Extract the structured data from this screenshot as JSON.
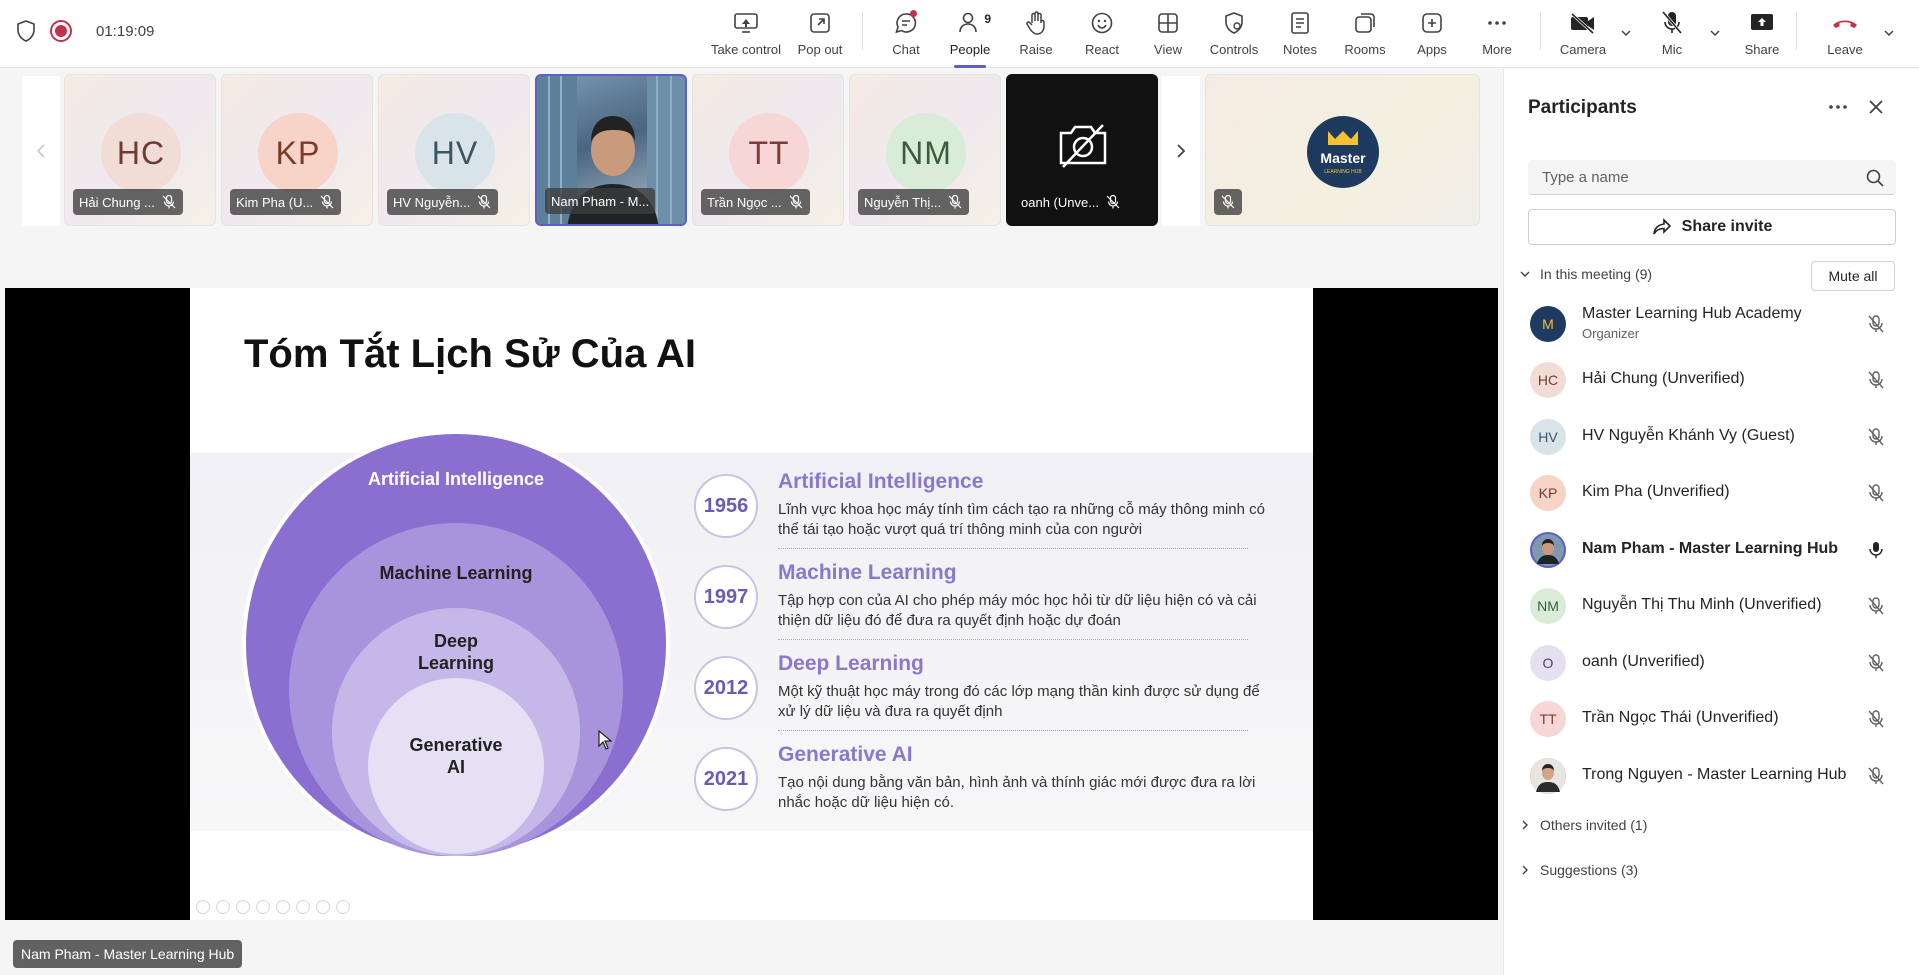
{
  "meeting": {
    "timer": "01:19:09"
  },
  "toolbar": {
    "take_control": "Take control",
    "pop_out": "Pop out",
    "chat": "Chat",
    "people": "People",
    "people_count": "9",
    "raise": "Raise",
    "react": "React",
    "view": "View",
    "controls": "Controls",
    "notes": "Notes",
    "rooms": "Rooms",
    "apps": "Apps",
    "more": "More",
    "camera": "Camera",
    "mic": "Mic",
    "share": "Share",
    "leave": "Leave"
  },
  "gallery": {
    "tiles": [
      {
        "initials": "HC",
        "name": "Hải Chung ...",
        "bg": "#f2dcd6",
        "fg": "#6b3d35"
      },
      {
        "initials": "KP",
        "name": "Kim Pha (U...",
        "bg": "#f7d3c8",
        "fg": "#7a3b2b"
      },
      {
        "initials": "HV",
        "name": "HV Nguyễn...",
        "bg": "#d9e4ea",
        "fg": "#3c5566"
      },
      {
        "initials": "",
        "name": "Nam Pham - M..."
      },
      {
        "initials": "TT",
        "name": "Trần Ngọc ...",
        "bg": "#f7d6d6",
        "fg": "#7a3b3b"
      },
      {
        "initials": "NM",
        "name": "Nguyễn Thị...",
        "bg": "#d8ecd8",
        "fg": "#3d5c3d"
      },
      {
        "initials": "",
        "name": "oanh (Unve..."
      }
    ]
  },
  "slide": {
    "title": "Tóm Tắt Lịch Sử Của AI",
    "circles": {
      "ai": "Artificial Intelligence",
      "ml": "Machine Learning",
      "dl_1": "Deep",
      "dl_2": "Learning",
      "gen_1": "Generative",
      "gen_2": "AI"
    },
    "timeline": [
      {
        "year": "1956",
        "title": "Artificial Intelligence",
        "desc": "Lĩnh vực khoa học máy tính tìm cách tạo ra những cỗ máy thông minh có thể tái tạo hoặc vượt quá trí thông minh của con người"
      },
      {
        "year": "1997",
        "title": "Machine Learning",
        "desc": "Tập hợp con của AI cho phép máy móc học hỏi từ dữ liệu hiện có và cải thiện dữ liệu đó để đưa ra quyết định hoặc dự đoán"
      },
      {
        "year": "2012",
        "title": "Deep Learning",
        "desc": "Một kỹ thuật học máy trong đó các lớp mạng thần kinh được sử dụng để xử lý dữ liệu và đưa ra quyết định"
      },
      {
        "year": "2021",
        "title": "Generative AI",
        "desc": "Tạo nội dung bằng văn bản, hình ảnh và thính giác mới được đưa ra lời nhắc hoặc dữ liệu hiện có."
      }
    ],
    "presenter": "Nam Pham - Master Learning Hub"
  },
  "panel": {
    "title": "Participants",
    "search_placeholder": "Type a name",
    "share_invite": "Share invite",
    "in_meeting": "In this meeting (9)",
    "mute_all": "Mute all",
    "others_invited": "Others invited (1)",
    "suggestions": "Suggestions (3)",
    "participants": [
      {
        "initials": "M",
        "name": "Master Learning Hub Academy",
        "role": "Organizer",
        "bg": "#1f3a5f",
        "fg": "#f2c230"
      },
      {
        "initials": "HC",
        "name": "Hải Chung (Unverified)",
        "role": "",
        "bg": "#f2dcd6",
        "fg": "#6b3d35"
      },
      {
        "initials": "HV",
        "name": "HV Nguyễn Khánh Vy (Guest)",
        "role": "",
        "bg": "#d9e4ea",
        "fg": "#3c5566"
      },
      {
        "initials": "KP",
        "name": "Kim Pha (Unverified)",
        "role": "",
        "bg": "#f7d3c8",
        "fg": "#7a3b2b"
      },
      {
        "initials": "",
        "name": "Nam Pham - Master Learning Hub",
        "role": "",
        "bg": "#5a6e80",
        "fg": "#ffffff"
      },
      {
        "initials": "NM",
        "name": "Nguyễn Thị Thu Minh (Unverified)",
        "role": "",
        "bg": "#d8ecd8",
        "fg": "#3d5c3d"
      },
      {
        "initials": "O",
        "name": "oanh (Unverified)",
        "role": "",
        "bg": "#e4e0f0",
        "fg": "#4a3f7a"
      },
      {
        "initials": "TT",
        "name": "Trần Ngọc Thái (Unverified)",
        "role": "",
        "bg": "#f7d6d6",
        "fg": "#7a3b3b"
      },
      {
        "initials": "",
        "name": "Trong Nguyen - Master Learning Hub",
        "role": "",
        "bg": "#6b5a4a",
        "fg": "#ffffff"
      }
    ]
  },
  "colors": {
    "accent": "#5b5fc7",
    "leave": "#c4314b",
    "slide_purple": "#8b78cc"
  }
}
